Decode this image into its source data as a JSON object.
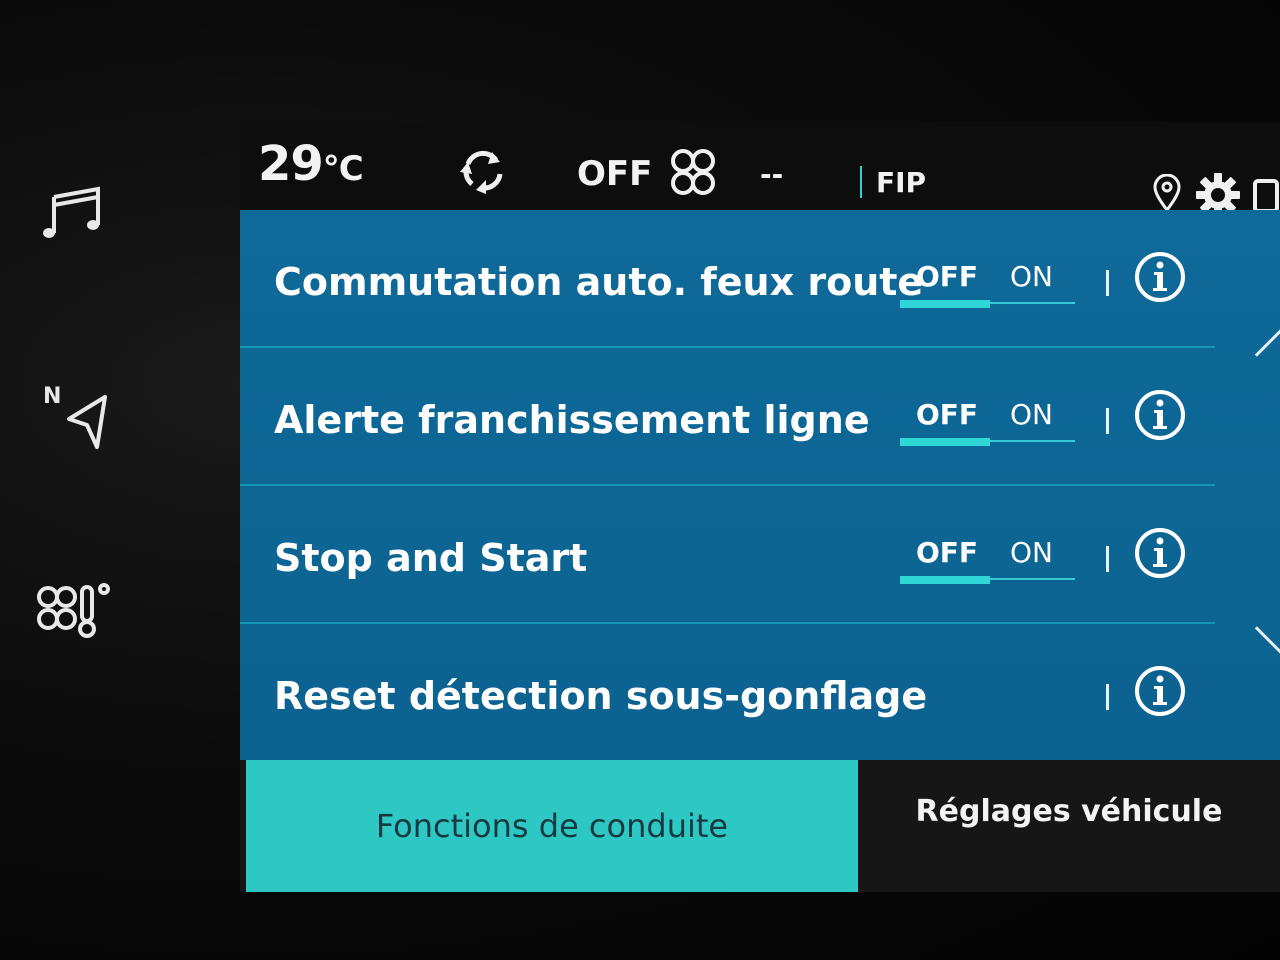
{
  "status_bar": {
    "temperature": "29",
    "temperature_unit": "°C",
    "recirculation_icon": "recirculation-icon",
    "fan_state": "OFF",
    "fan_icon": "fan-icon",
    "fan_level": "--",
    "radio_station": "FIP",
    "icons": [
      "location-pin-icon",
      "gear-icon",
      "phone-icon"
    ]
  },
  "side_buttons": [
    "music-note-icon",
    "navigation-icon",
    "climate-icon"
  ],
  "navigation_label": "N",
  "settings": [
    {
      "label": "Commutation auto. feux route",
      "toggle": {
        "off": "OFF",
        "on": "ON",
        "state": "OFF"
      },
      "info_icon": "info-icon"
    },
    {
      "label": "Alerte franchissement ligne",
      "toggle": {
        "off": "OFF",
        "on": "ON",
        "state": "OFF"
      },
      "info_icon": "info-icon"
    },
    {
      "label": "Stop and Start",
      "toggle": {
        "off": "OFF",
        "on": "ON",
        "state": "OFF"
      },
      "info_icon": "info-icon"
    },
    {
      "label": "Reset détection sous-gonflage",
      "info_icon": "info-icon"
    }
  ],
  "tabs": {
    "active": "Fonctions de conduite",
    "inactive": "Réglages véhicule"
  },
  "colors": {
    "list_background": "#0c6490",
    "accent": "#2ec8c4",
    "text": "#ffffff"
  }
}
